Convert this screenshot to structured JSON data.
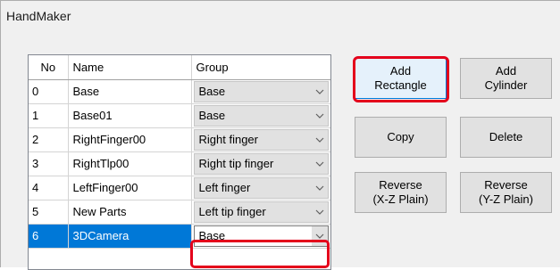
{
  "window": {
    "title": "HandMaker"
  },
  "table": {
    "headers": {
      "no": "No",
      "name": "Name",
      "group": "Group"
    },
    "rows": [
      {
        "no": "0",
        "name": "Base",
        "group": "Base"
      },
      {
        "no": "1",
        "name": "Base01",
        "group": "Base"
      },
      {
        "no": "2",
        "name": "RightFinger00",
        "group": "Right finger"
      },
      {
        "no": "3",
        "name": "RightTlp00",
        "group": "Right tip finger"
      },
      {
        "no": "4",
        "name": "LeftFinger00",
        "group": "Left finger"
      },
      {
        "no": "5",
        "name": "New Parts",
        "group": "Left tip finger"
      },
      {
        "no": "6",
        "name": "3DCamera",
        "group": "Base",
        "selected": true
      }
    ]
  },
  "buttons": {
    "add_rectangle": "Add\nRectangle",
    "add_cylinder": "Add\nCylinder",
    "copy": "Copy",
    "delete": "Delete",
    "reverse_xz": "Reverse\n(X-Z Plain)",
    "reverse_yz": "Reverse\n(Y-Z Plain)"
  },
  "colors": {
    "selection": "#0078d7",
    "highlight": "#e4001b",
    "button_face": "#e1e1e1"
  },
  "icons": {
    "dropdown": "chevron-down-icon"
  }
}
